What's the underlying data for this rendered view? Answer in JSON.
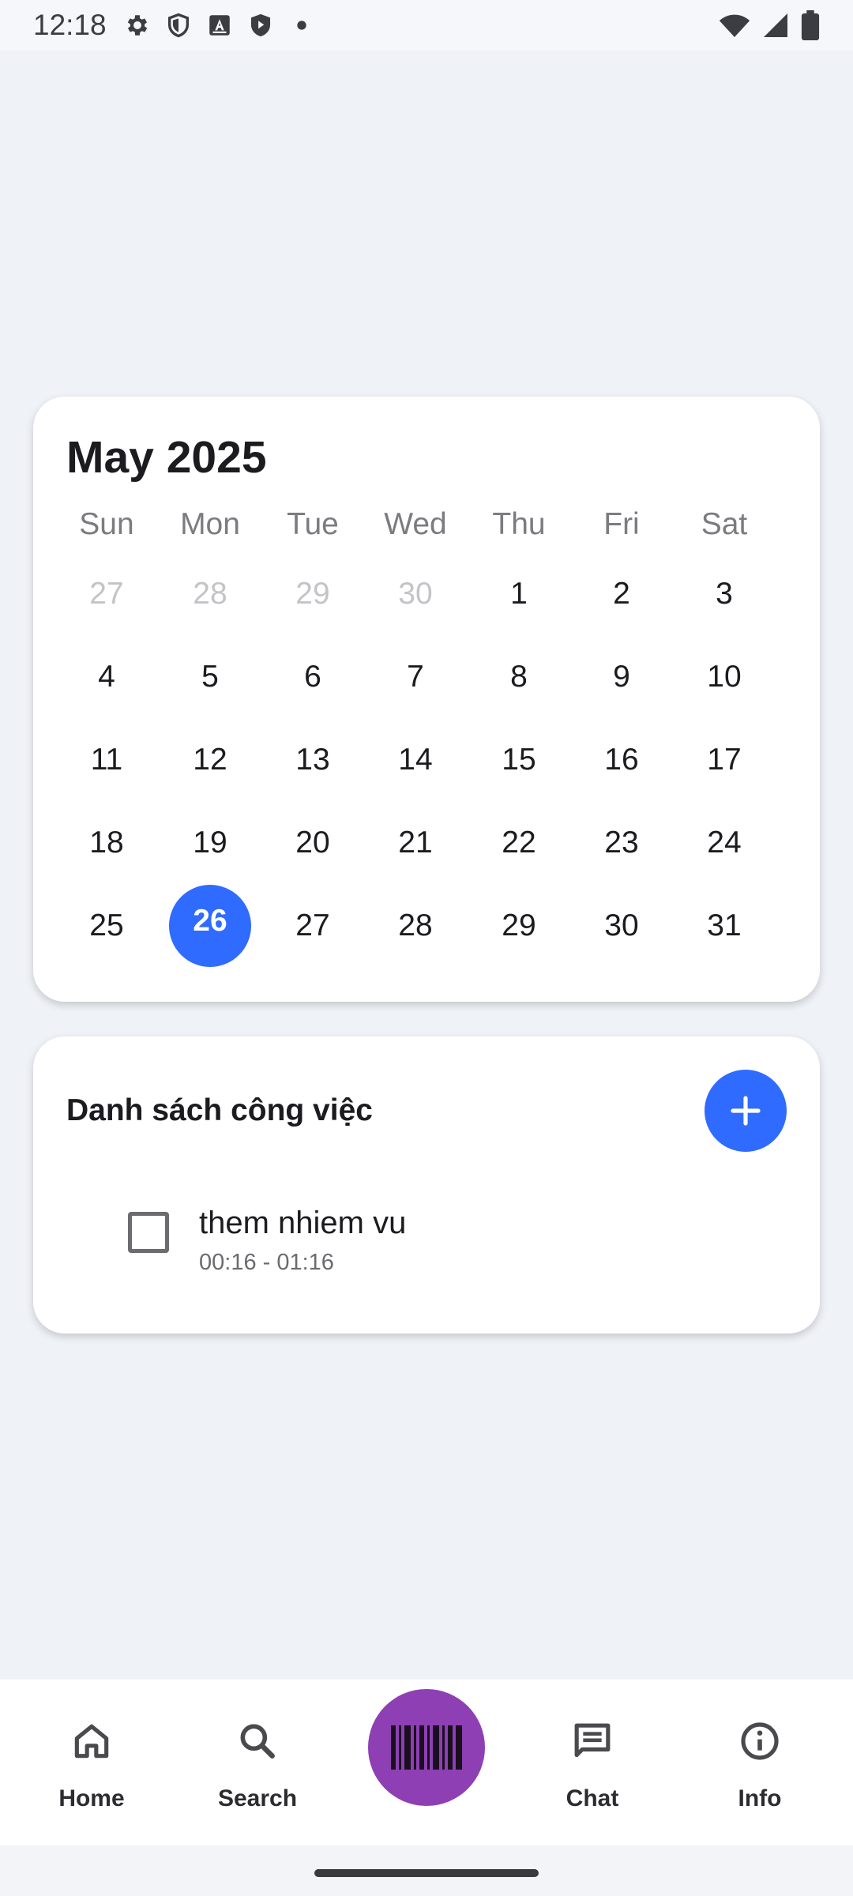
{
  "status_bar": {
    "time": "12:18",
    "left_icons": [
      "gear-icon",
      "shield-icon",
      "font-icon",
      "shield-play-icon",
      "dot-icon"
    ],
    "right_icons": [
      "wifi-icon",
      "signal-icon",
      "battery-icon"
    ]
  },
  "calendar": {
    "month_label": "May 2025",
    "weekdays": [
      "Sun",
      "Mon",
      "Tue",
      "Wed",
      "Thu",
      "Fri",
      "Sat"
    ],
    "weeks": [
      [
        {
          "d": "27",
          "m": true
        },
        {
          "d": "28",
          "m": true
        },
        {
          "d": "29",
          "m": true
        },
        {
          "d": "30",
          "m": true
        },
        {
          "d": "1"
        },
        {
          "d": "2"
        },
        {
          "d": "3"
        }
      ],
      [
        {
          "d": "4"
        },
        {
          "d": "5"
        },
        {
          "d": "6"
        },
        {
          "d": "7"
        },
        {
          "d": "8"
        },
        {
          "d": "9"
        },
        {
          "d": "10"
        }
      ],
      [
        {
          "d": "11"
        },
        {
          "d": "12"
        },
        {
          "d": "13"
        },
        {
          "d": "14"
        },
        {
          "d": "15"
        },
        {
          "d": "16"
        },
        {
          "d": "17"
        }
      ],
      [
        {
          "d": "18"
        },
        {
          "d": "19"
        },
        {
          "d": "20"
        },
        {
          "d": "21"
        },
        {
          "d": "22"
        },
        {
          "d": "23"
        },
        {
          "d": "24"
        }
      ],
      [
        {
          "d": "25"
        },
        {
          "d": "26",
          "s": true
        },
        {
          "d": "27"
        },
        {
          "d": "28"
        },
        {
          "d": "29"
        },
        {
          "d": "30"
        },
        {
          "d": "31"
        }
      ]
    ],
    "selected_day": "26",
    "accent_color": "#2f6bff"
  },
  "tasks": {
    "title": "Danh sách công việc",
    "add_icon": "plus-icon",
    "items": [
      {
        "name": "them nhiem vu",
        "time": "00:16 - 01:16",
        "checked": false
      }
    ]
  },
  "bottom_nav": {
    "items": [
      {
        "label": "Home",
        "icon": "home-icon"
      },
      {
        "label": "Search",
        "icon": "search-icon"
      },
      {
        "label": "Chat",
        "icon": "chat-icon"
      },
      {
        "label": "Info",
        "icon": "info-icon"
      }
    ],
    "scan_icon": "barcode-icon",
    "scan_color": "#8e3fb4"
  }
}
